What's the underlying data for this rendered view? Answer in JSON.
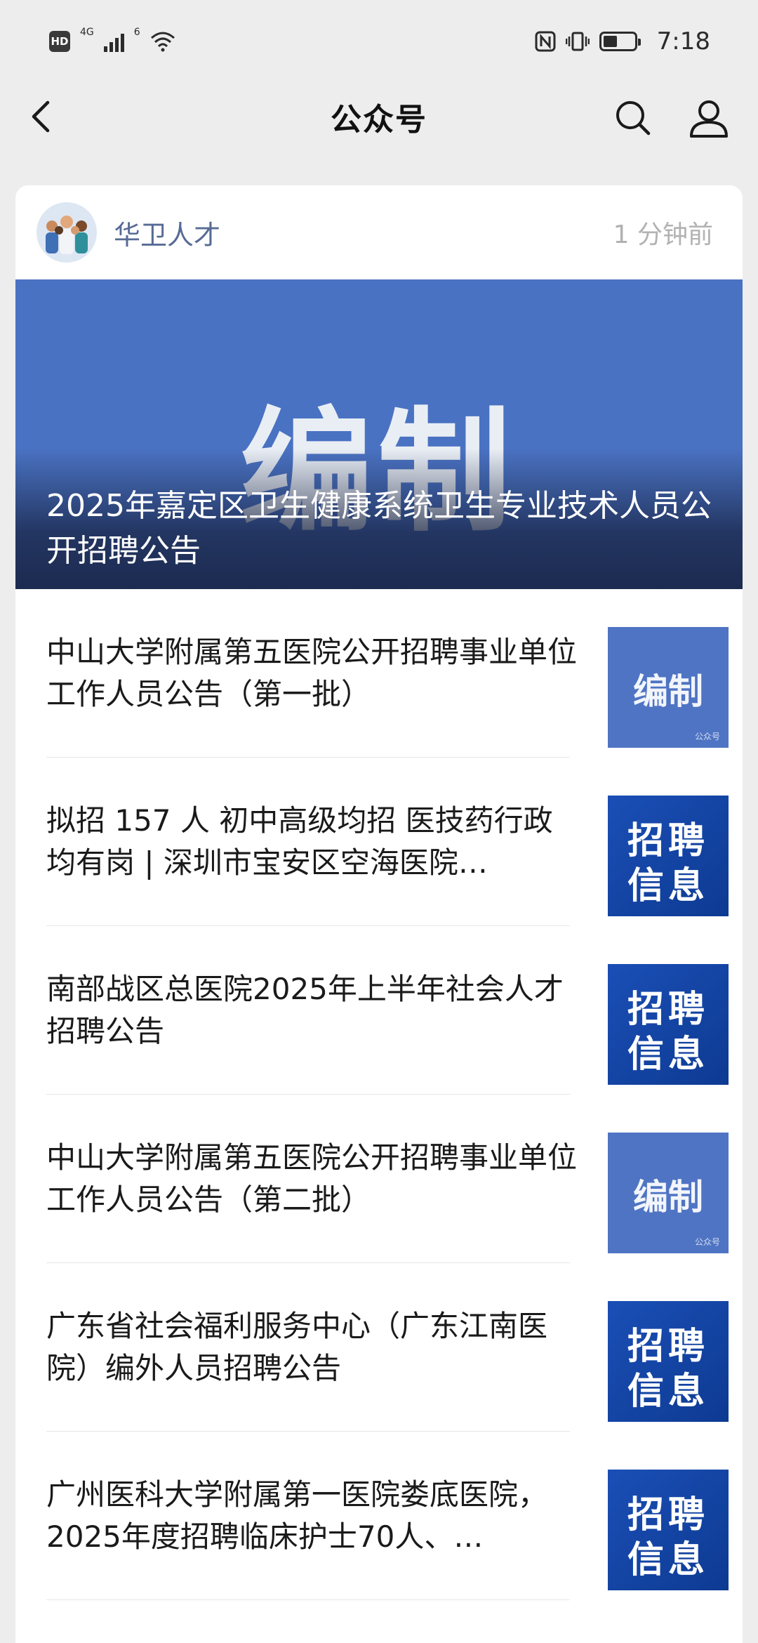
{
  "status_bar": {
    "hd": "HD",
    "net_4g": "4G",
    "wifi_6": "6",
    "time": "7:18"
  },
  "nav": {
    "title": "公众号"
  },
  "card": {
    "account_name": "华卫人才",
    "time_ago": "1 分钟前",
    "cover": {
      "image_word": "编制",
      "title": "2025年嘉定区卫生健康系统卫生专业技术人员公开招聘公告"
    },
    "articles": [
      {
        "title": "中山大学附属第五医院公开招聘事业单位工作人员公告（第一批）",
        "thumb_type": "bianzhi",
        "thumb_text": "编制",
        "thumb_watermark": "公众号"
      },
      {
        "title": "拟招 157 人 初中高级均招 医技药行政均有岗 | 深圳市宝安区空海医院…",
        "thumb_type": "zhaopin",
        "thumb_line1": "招聘",
        "thumb_line2": "信息"
      },
      {
        "title": "南部战区总医院2025年上半年社会人才招聘公告",
        "thumb_type": "zhaopin",
        "thumb_line1": "招聘",
        "thumb_line2": "信息"
      },
      {
        "title": "中山大学附属第五医院公开招聘事业单位工作人员公告（第二批）",
        "thumb_type": "bianzhi",
        "thumb_text": "编制",
        "thumb_watermark": "公众号"
      },
      {
        "title": "广东省社会福利服务中心（广东江南医院）编外人员招聘公告",
        "thumb_type": "zhaopin",
        "thumb_line1": "招聘",
        "thumb_line2": "信息"
      },
      {
        "title": "广州医科大学附属第一医院娄底医院，2025年度招聘临床护士70人、…",
        "thumb_type": "zhaopin",
        "thumb_line1": "招聘",
        "thumb_line2": "信息"
      }
    ]
  },
  "colors": {
    "background": "#ededed",
    "account_name": "#576b95",
    "cover_blue": "#4a72c2",
    "thumb_blue": "#1b4fb6"
  }
}
